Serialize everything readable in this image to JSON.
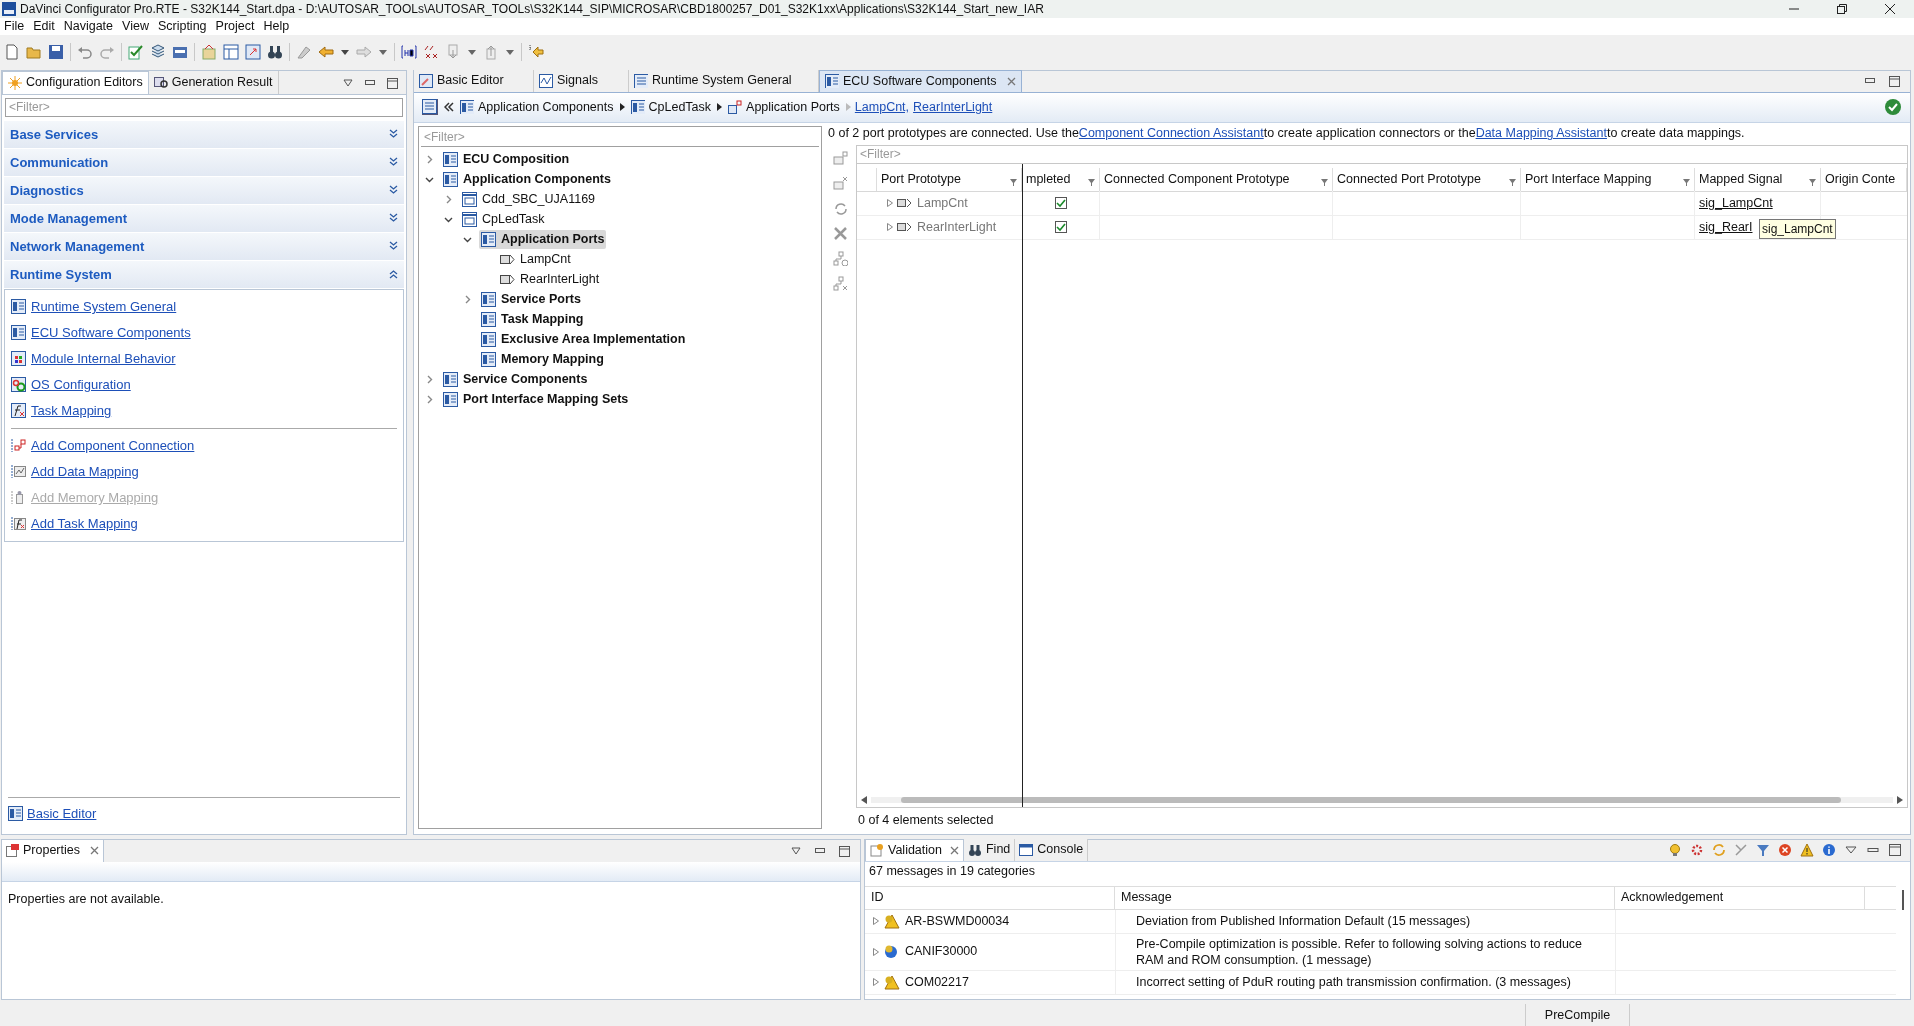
{
  "window": {
    "title": "DaVinci Configurator Pro.RTE - S32K144_Start.dpa - D:\\AUTOSAR_TOOLs\\AUTOSAR_TOOLs\\S32K144_SIP\\MICROSAR\\CBD1800257_D01_S32K1xx\\Applications\\S32K144_Start_new_IAR"
  },
  "menu": [
    "File",
    "Edit",
    "Navigate",
    "View",
    "Scripting",
    "Project",
    "Help"
  ],
  "left_panel": {
    "tabs": [
      {
        "label": "Configuration Editors",
        "selected": true
      },
      {
        "label": "Generation Result",
        "selected": false
      }
    ],
    "filter": {
      "placeholder": "<Filter>"
    },
    "sections": [
      {
        "label": "Base Services",
        "expanded": false
      },
      {
        "label": "Communication",
        "expanded": false
      },
      {
        "label": "Diagnostics",
        "expanded": false
      },
      {
        "label": "Mode Management",
        "expanded": false
      },
      {
        "label": "Network Management",
        "expanded": false
      },
      {
        "label": "Runtime System",
        "expanded": true
      }
    ],
    "editor_links": [
      {
        "label": "Runtime System General",
        "disabled": false
      },
      {
        "label": "ECU Software Components",
        "disabled": false
      },
      {
        "label": "Module Internal Behavior",
        "disabled": false
      },
      {
        "label": "OS Configuration",
        "disabled": false
      },
      {
        "label": "Task Mapping",
        "disabled": false
      }
    ],
    "action_links": [
      {
        "label": "Add Component Connection",
        "disabled": false
      },
      {
        "label": "Add Data Mapping",
        "disabled": false
      },
      {
        "label": "Add Memory Mapping",
        "disabled": true
      },
      {
        "label": "Add Task Mapping",
        "disabled": false
      }
    ],
    "footer_link": "Basic Editor"
  },
  "editor": {
    "tabs": [
      {
        "label": "Basic Editor",
        "selected": false
      },
      {
        "label": "Signals",
        "selected": false
      },
      {
        "label": "Runtime System General",
        "selected": false
      },
      {
        "label": "ECU Software Components",
        "selected": true
      }
    ],
    "breadcrumb": {
      "items": [
        "Application Components",
        "CpLedTask",
        "Application Ports"
      ],
      "links": [
        "LampCnt,",
        "RearInterLight"
      ]
    },
    "tree": {
      "filter": {
        "placeholder": "<Filter>"
      },
      "nodes": [
        {
          "label": "ECU Composition",
          "kind": "category",
          "expanded": false,
          "selected": false
        },
        {
          "label": "Application Components",
          "kind": "category",
          "expanded": true,
          "selected": false,
          "children": [
            {
              "label": "Cdd_SBC_UJA1169",
              "kind": "item",
              "expanded": false,
              "selected": false
            },
            {
              "label": "CpLedTask",
              "kind": "item",
              "expanded": true,
              "selected": false,
              "children": [
                {
                  "label": "Application Ports",
                  "kind": "category",
                  "expanded": true,
                  "selected": true,
                  "children": [
                    {
                      "label": "LampCnt",
                      "kind": "port",
                      "selected": false
                    },
                    {
                      "label": "RearInterLight",
                      "kind": "port",
                      "selected": false
                    }
                  ]
                },
                {
                  "label": "Service Ports",
                  "kind": "category",
                  "expanded": false,
                  "selected": false
                },
                {
                  "label": "Task Mapping",
                  "kind": "category",
                  "selected": false
                },
                {
                  "label": "Exclusive Area Implementation",
                  "kind": "category",
                  "selected": false
                },
                {
                  "label": "Memory Mapping",
                  "kind": "category",
                  "selected": false
                }
              ]
            }
          ]
        },
        {
          "label": "Service Components",
          "kind": "category",
          "expanded": false,
          "selected": false
        },
        {
          "label": "Port Interface Mapping Sets",
          "kind": "category",
          "expanded": false,
          "selected": false
        }
      ]
    },
    "info": [
      {
        "kind": "text",
        "text": "0 of 2 port prototypes are connected. Use the "
      },
      {
        "kind": "link",
        "text": "Component Connection Assistant"
      },
      {
        "kind": "text",
        "text": " to create application connectors or the "
      },
      {
        "kind": "link",
        "text": "Data Mapping Assistant"
      },
      {
        "kind": "text",
        "text": " to create data mappings."
      }
    ],
    "table": {
      "filter": {
        "placeholder": "<Filter>"
      },
      "columns": [
        "Port Prototype",
        "mpleted",
        "Connected Component Prototype",
        "Connected Port Prototype",
        "Port Interface Mapping",
        "Mapped Signal",
        "Origin Conte"
      ],
      "rows": [
        {
          "port": "LampCnt",
          "expanded": false,
          "completed": true,
          "mapped_signal": "sig_LampCnt"
        },
        {
          "port": "RearInterLight",
          "expanded": false,
          "completed": true,
          "mapped_signal": "sig_RearI"
        }
      ],
      "tooltip": "sig_LampCnt",
      "status": "0 of 4 elements selected"
    }
  },
  "properties": {
    "title": "Properties",
    "message": "Properties are not available."
  },
  "validation": {
    "tabs": [
      {
        "label": "Validation",
        "selected": true
      },
      {
        "label": "Find",
        "selected": false
      },
      {
        "label": "Console",
        "selected": false
      }
    ],
    "summary": "67 messages in 19 categories",
    "columns": [
      "ID",
      "Message",
      "Acknowledgement"
    ],
    "rows": [
      {
        "id": "AR-BSWMD00034",
        "kind": "warning",
        "message": "Deviation from Published Information Default (15 messages)"
      },
      {
        "id": "CANIF30000",
        "kind": "info",
        "message": "Pre-Compile optimization is possible. Refer to following solving actions to reduce RAM and ROM consumption. (1 message)"
      },
      {
        "id": "COM02217",
        "kind": "warning",
        "message": "Incorrect setting of PduR routing path transmission confirmation. (3 messages)"
      }
    ]
  },
  "status_bar": {
    "mode": "PreCompile"
  }
}
